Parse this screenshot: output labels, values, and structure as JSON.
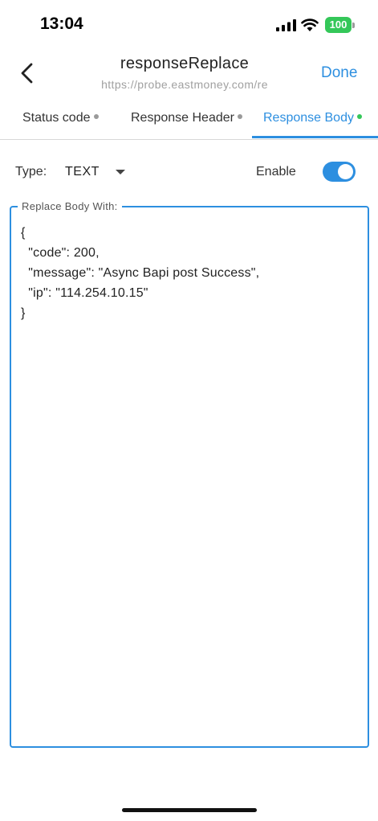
{
  "status_bar": {
    "time": "13:04",
    "battery": "100",
    "battery_color": "#34c759"
  },
  "nav": {
    "title": "responseReplace",
    "subtitle": "https://probe.eastmoney.com/re",
    "done_label": "Done",
    "back_icon": "chevron-left-icon"
  },
  "tabs": [
    {
      "label": "Status code",
      "dot_color": "#9a9a9a",
      "active": false
    },
    {
      "label": "Response Header",
      "dot_color": "#9a9a9a",
      "active": false
    },
    {
      "label": "Response Body",
      "dot_color": "#34c759",
      "active": true
    }
  ],
  "type_row": {
    "type_label": "Type:",
    "type_value": "TEXT",
    "enable_label": "Enable",
    "enabled": true
  },
  "body": {
    "legend": "Replace Body With:",
    "content": "{\n  \"code\": 200,\n  \"message\": \"Async Bapi post Success\",\n  \"ip\": \"114.254.10.15\"\n}"
  },
  "colors": {
    "accent": "#2d8fe0"
  }
}
